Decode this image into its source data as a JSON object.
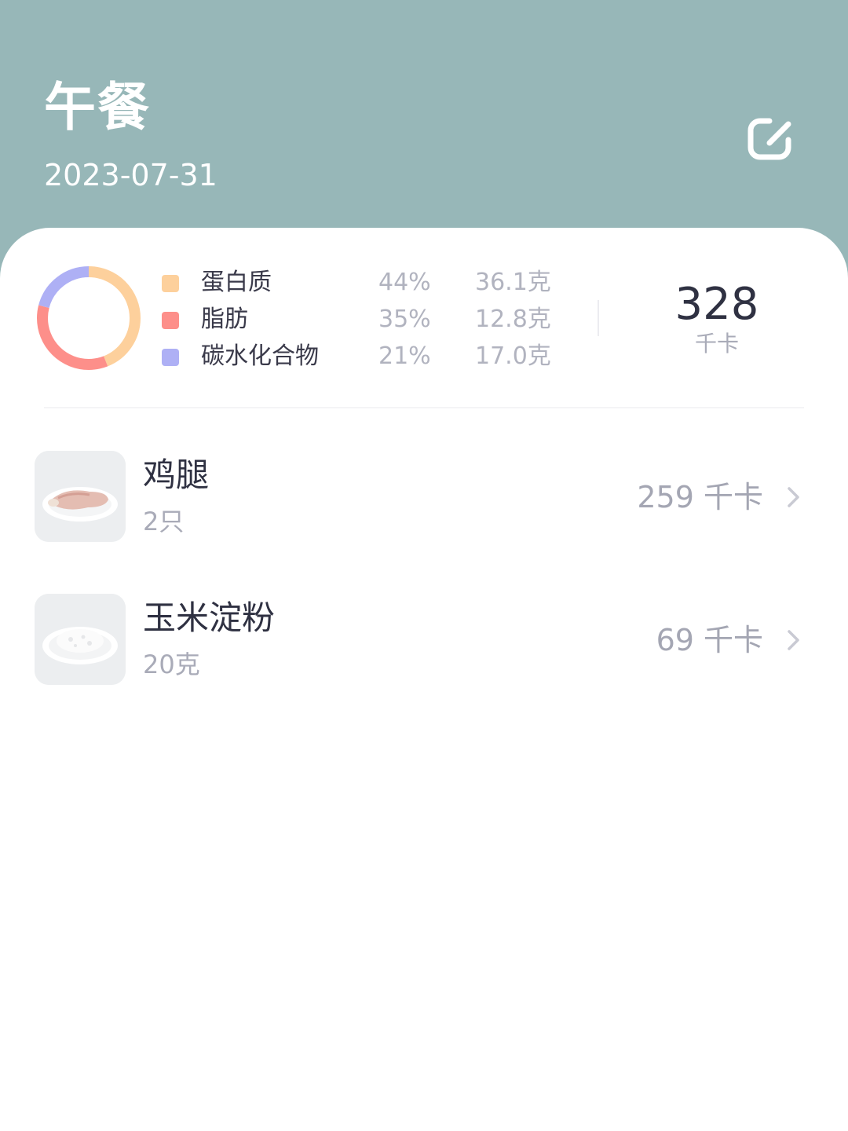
{
  "header": {
    "title": "午餐",
    "date": "2023-07-31",
    "edit_icon": "edit-icon"
  },
  "summary": {
    "macros": [
      {
        "name": "蛋白质",
        "percent": "44%",
        "grams": "36.1克",
        "color": "#fdd09c"
      },
      {
        "name": "脂肪",
        "percent": "35%",
        "grams": "12.8克",
        "color": "#fd8f8a"
      },
      {
        "name": "碳水化合物",
        "percent": "21%",
        "grams": "17.0克",
        "color": "#aeb0f5"
      }
    ],
    "total_kcal": "328",
    "kcal_unit": "千卡"
  },
  "foods": [
    {
      "name": "鸡腿",
      "quantity": "2只",
      "kcal": "259 千卡",
      "image_icon": "chicken-leg-icon"
    },
    {
      "name": "玉米淀粉",
      "quantity": "20克",
      "kcal": "69 千卡",
      "image_icon": "corn-starch-icon"
    }
  ],
  "colors": {
    "header_bg": "#97b7b8",
    "card_bg": "#ffffff",
    "protein": "#fdd09c",
    "fat": "#fd8f8a",
    "carbs": "#aeb0f5"
  },
  "chart_data": {
    "type": "pie",
    "categories": [
      "蛋白质",
      "脂肪",
      "碳水化合物"
    ],
    "values": [
      44,
      35,
      21
    ]
  }
}
